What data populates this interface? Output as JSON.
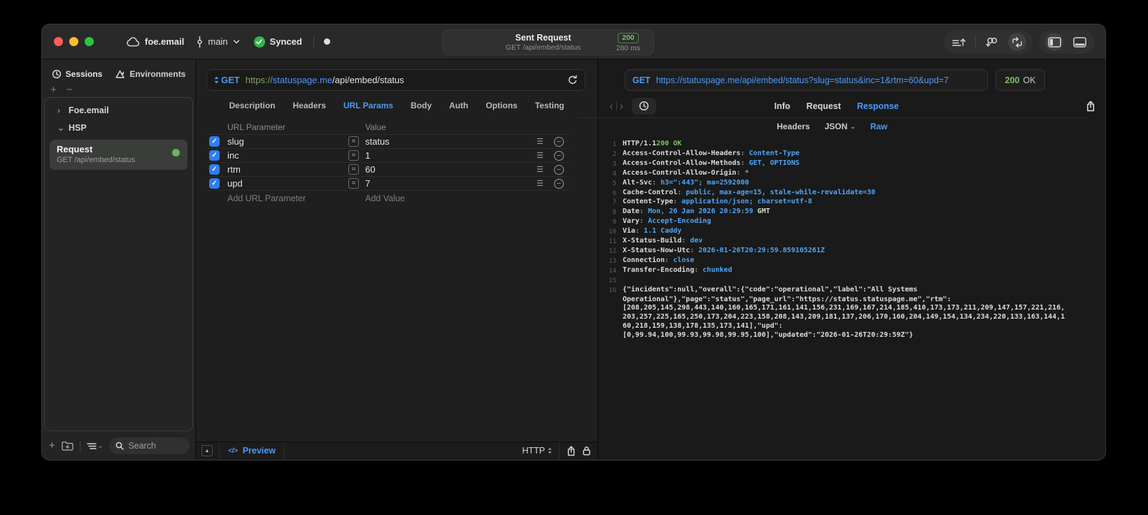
{
  "colors": {
    "accent": "#4c9af8",
    "green": "#7cc05e"
  },
  "titlebar": {
    "project": "foe.email",
    "branch": "main",
    "sync_status": "Synced",
    "request": {
      "title": "Sent Request",
      "subtitle": "GET /api/embed/status",
      "status_code": "200",
      "duration": "280 ms"
    }
  },
  "sidebar": {
    "tabs": [
      {
        "label": "Sessions"
      },
      {
        "label": "Environments"
      }
    ],
    "tree": [
      {
        "label": "Foe.email"
      },
      {
        "label": "HSP"
      }
    ],
    "request_item": {
      "title": "Request",
      "subtitle": "GET /api/embed/status"
    },
    "search_placeholder": "Search"
  },
  "request_panel": {
    "method": "GET",
    "url": {
      "scheme": "https://",
      "host": "statuspage.me",
      "path": "/api/embed/status"
    },
    "tabs": [
      {
        "label": "Description"
      },
      {
        "label": "Headers"
      },
      {
        "label": "URL Params",
        "active": true
      },
      {
        "label": "Body"
      },
      {
        "label": "Auth"
      },
      {
        "label": "Options"
      },
      {
        "label": "Testing"
      }
    ],
    "table": {
      "param_header": "URL Parameter",
      "value_header": "Value",
      "rows": [
        {
          "name": "slug",
          "value": "status",
          "enabled": true
        },
        {
          "name": "inc",
          "value": "1",
          "enabled": true
        },
        {
          "name": "rtm",
          "value": "60",
          "enabled": true
        },
        {
          "name": "upd",
          "value": "7",
          "enabled": true
        }
      ],
      "add_param": "Add URL Parameter",
      "add_value": "Add Value"
    },
    "footer": {
      "preview_icon": "</>",
      "preview": "Preview",
      "protocol": "HTTP"
    }
  },
  "response_panel": {
    "request_line": {
      "method": "GET",
      "url": "https://statuspage.me/api/embed/status?slug=status&inc=1&rtm=60&upd=7"
    },
    "status": {
      "code": "200",
      "label": "OK"
    },
    "tabs": [
      {
        "label": "Info"
      },
      {
        "label": "Request"
      },
      {
        "label": "Response",
        "active": true
      }
    ],
    "subtabs": [
      {
        "label": "Headers"
      },
      {
        "label": "JSON",
        "dropdown": true
      },
      {
        "label": "Raw",
        "active": true
      }
    ],
    "code": {
      "status_line": {
        "num": "1",
        "protocol": "HTTP/1.1",
        "status": "200 OK"
      },
      "headers": [
        {
          "num": "2",
          "name": "Access-Control-Allow-Headers",
          "value": "Content-Type"
        },
        {
          "num": "3",
          "name": "Access-Control-Allow-Methods",
          "value": "GET, OPTIONS"
        },
        {
          "num": "4",
          "name": "Access-Control-Allow-Origin",
          "value": "*",
          "plain": true
        },
        {
          "num": "5",
          "name": "Alt-Svc",
          "value": "h3=\":443\"; ma=2592000"
        },
        {
          "num": "6",
          "name": "Cache-Control",
          "value": "public, max-age=15, stale-while-revalidate=30"
        },
        {
          "num": "7",
          "name": "Content-Type",
          "value": "application/json; charset=utf-8"
        },
        {
          "num": "8",
          "name": "Date",
          "value": "Mon, 26 Jan 2026 20:29:59",
          "suffix": " GMT"
        },
        {
          "num": "9",
          "name": "Vary",
          "value": "Accept-Encoding"
        },
        {
          "num": "10",
          "name": "Via",
          "value": "1.1 Caddy"
        },
        {
          "num": "11",
          "name": "X-Status-Build",
          "value": "dev"
        },
        {
          "num": "12",
          "name": "X-Status-Now-Utc",
          "value": "2026-01-26T20:29:59.859105261Z"
        },
        {
          "num": "13",
          "name": "Connection",
          "value": "close"
        },
        {
          "num": "14",
          "name": "Transfer-Encoding",
          "value": "chunked"
        }
      ],
      "blank_line_num": "15",
      "body_num": "16",
      "body_lines": [
        "{\"incidents\":null,\"overall\":{\"code\":\"operational\",\"label\":\"All Systems",
        "Operational\"},\"page\":\"status\",\"page_url\":\"https://status.statuspage.me\",\"rtm\":",
        "[208,205,145,298,443,140,160,165,171,161,141,156,231,169,167,214,185,410,173,173,211,209,147,157,221,216,",
        "203,257,225,165,250,173,204,223,158,208,143,209,181,137,206,170,160,204,149,154,134,234,220,133,163,144,1",
        "60,218,159,138,178,135,173,141],\"upd\":",
        "[0,99.94,100,99.93,99.98,99.95,100],\"updated\":\"2026-01-26T20:29:59Z\"}"
      ]
    }
  }
}
